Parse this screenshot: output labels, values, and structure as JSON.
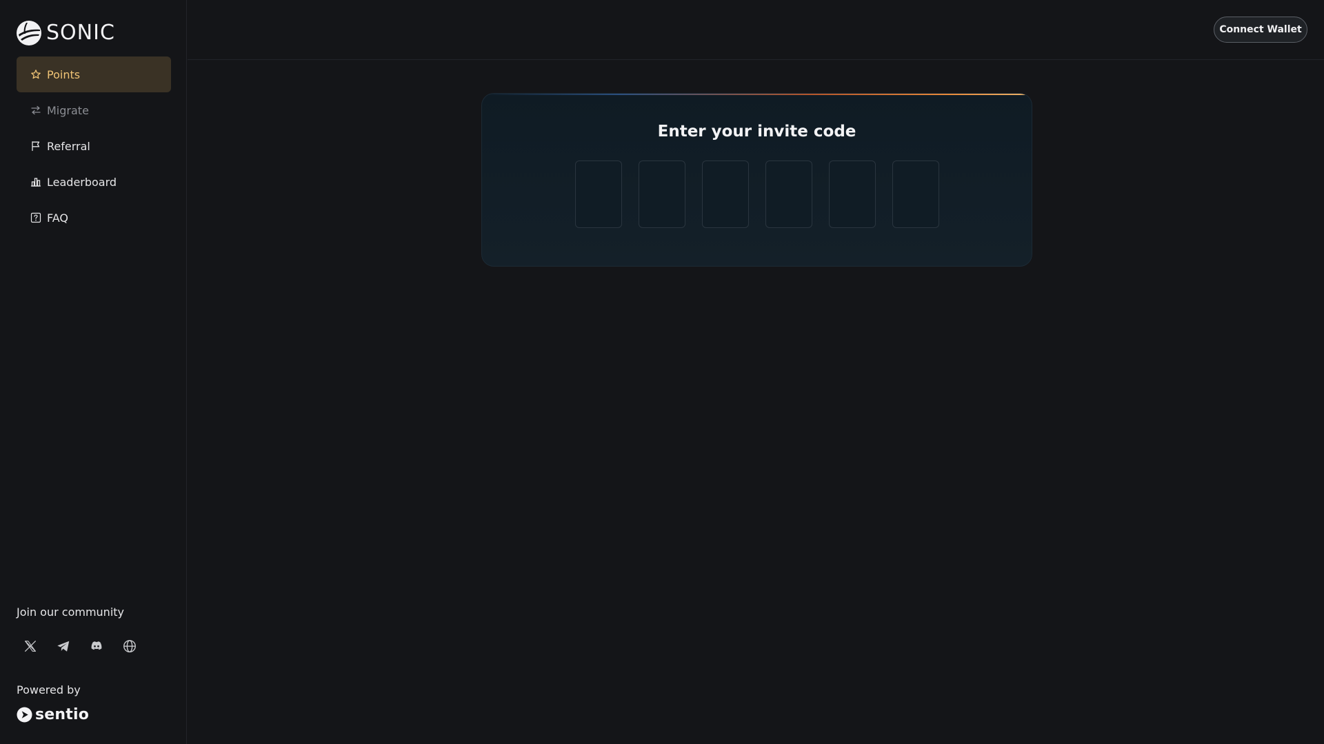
{
  "brand": {
    "name": "SONIC",
    "logo_icon": "sonic-logo-icon"
  },
  "sidebar": {
    "items": [
      {
        "label": "Points",
        "icon": "star-icon",
        "state": "active"
      },
      {
        "label": "Migrate",
        "icon": "swap-arrows-icon",
        "state": "disabled"
      },
      {
        "label": "Referral",
        "icon": "flag-icon",
        "state": "normal"
      },
      {
        "label": "Leaderboard",
        "icon": "bar-chart-icon",
        "state": "normal"
      },
      {
        "label": "FAQ",
        "icon": "question-icon",
        "state": "normal"
      }
    ],
    "community_label": "Join our community",
    "socials": [
      {
        "icon": "x-icon"
      },
      {
        "icon": "telegram-icon"
      },
      {
        "icon": "discord-icon"
      },
      {
        "icon": "globe-icon"
      }
    ],
    "powered_label": "Powered by",
    "powered_brand": "sentio"
  },
  "header": {
    "connect_label": "Connect Wallet"
  },
  "invite": {
    "title": "Enter your invite code",
    "codes": [
      "",
      "",
      "",
      "",
      "",
      ""
    ]
  },
  "colors": {
    "background": "#141518",
    "active_nav_bg": "#3a3225",
    "accent_gold": "#f0c476",
    "card_bg": "#0f1b24",
    "accent_orange": "#e7893a"
  }
}
